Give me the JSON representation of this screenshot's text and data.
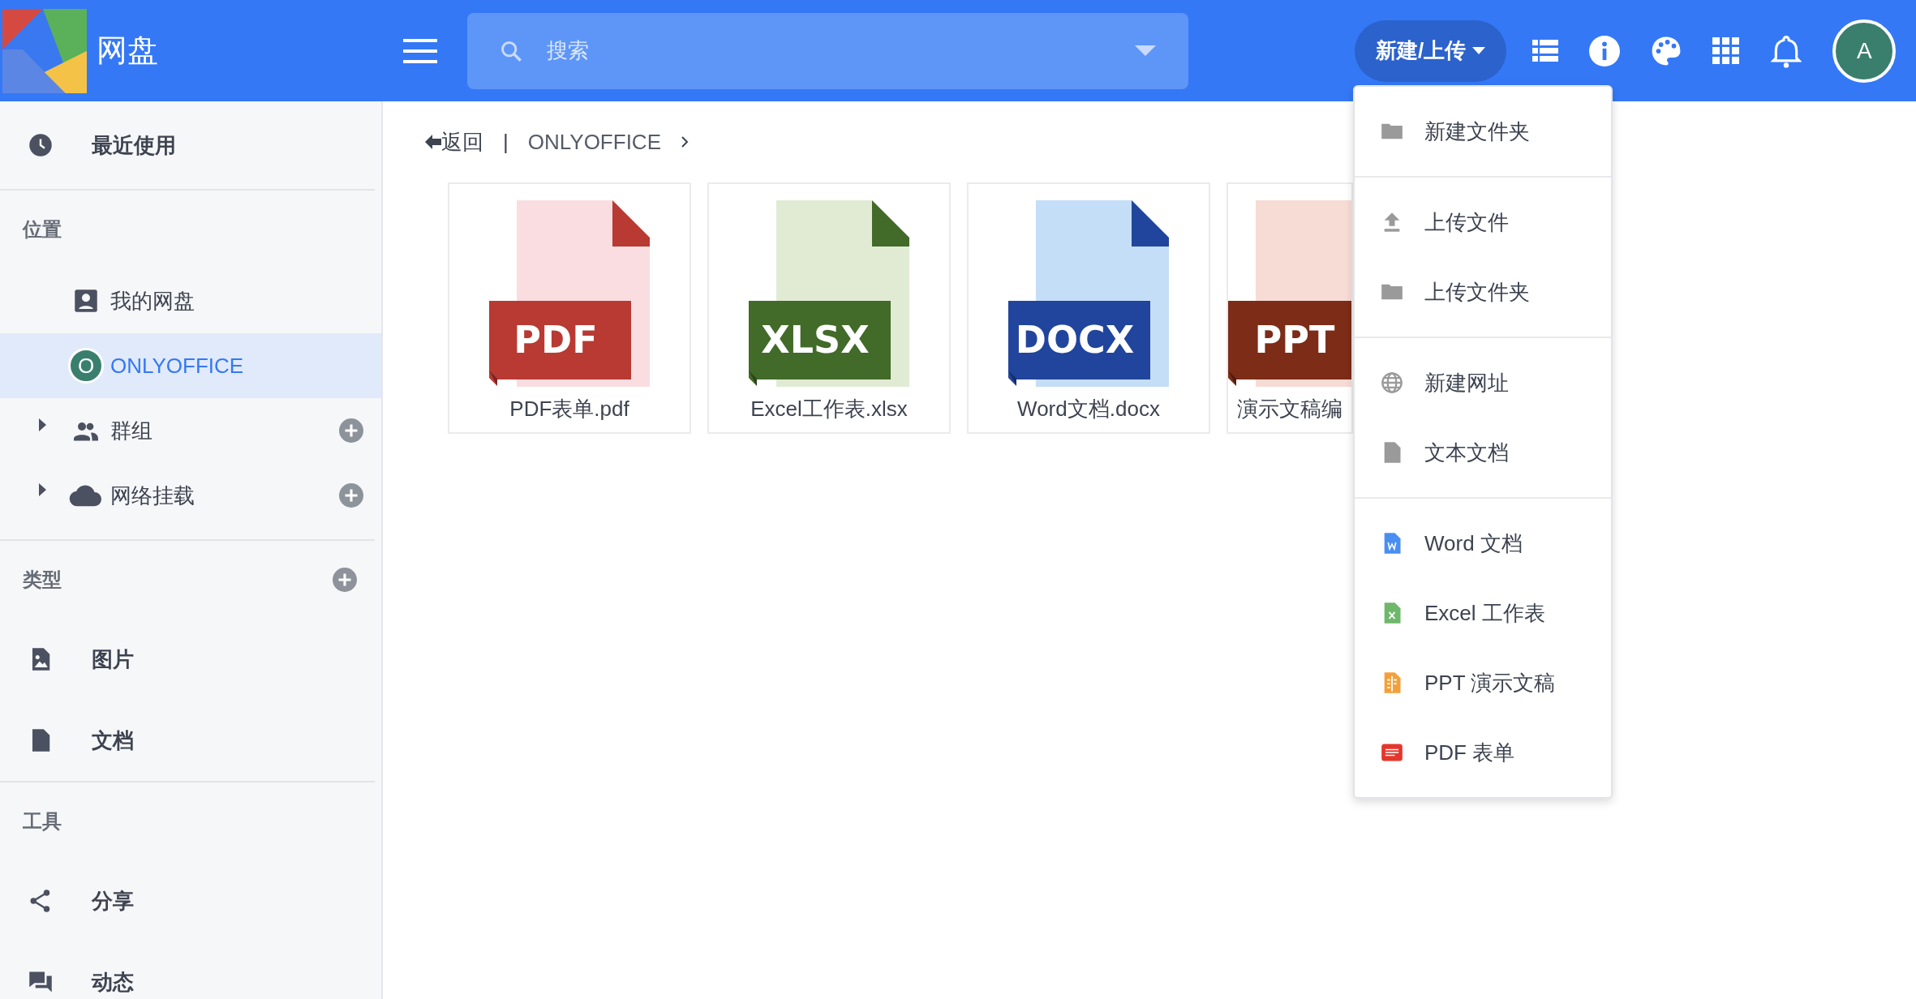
{
  "header": {
    "app_name": "网盘",
    "search": {
      "placeholder": "搜索"
    },
    "new_button": "新建/上传",
    "avatar": "A"
  },
  "sidebar": {
    "recent": {
      "label": "最近使用",
      "selected": false
    },
    "sections": [
      {
        "title": "位置",
        "add": false,
        "items": [
          {
            "kind": "person",
            "label": "我的网盘",
            "selected": false,
            "expandable": false,
            "add": false
          },
          {
            "kind": "letter",
            "badge": "O",
            "label": "ONLYOFFICE",
            "selected": true,
            "expandable": false,
            "add": false
          },
          {
            "kind": "people",
            "label": "群组",
            "selected": false,
            "expandable": true,
            "add": true
          },
          {
            "kind": "cloud",
            "label": "网络挂载",
            "selected": false,
            "expandable": true,
            "add": true
          }
        ]
      },
      {
        "title": "类型",
        "add": true,
        "items": [
          {
            "kind": "image",
            "label": "图片",
            "selected": false,
            "expandable": false,
            "add": false
          },
          {
            "kind": "file",
            "label": "文档",
            "selected": false,
            "expandable": false,
            "add": false
          }
        ]
      },
      {
        "title": "工具",
        "add": false,
        "items": [
          {
            "kind": "share",
            "label": "分享",
            "selected": false,
            "expandable": false,
            "add": false
          },
          {
            "kind": "chat",
            "label": "动态",
            "selected": false,
            "expandable": false,
            "add": false
          }
        ]
      }
    ]
  },
  "breadcrumb": {
    "back": "返回",
    "separator": "|",
    "path": [
      "ONLYOFFICE"
    ]
  },
  "files": [
    {
      "kind": "pdf",
      "badge": "PDF",
      "name": "PDF表单.pdf"
    },
    {
      "kind": "xlsx",
      "badge": "XLSX",
      "name": "Excel工作表.xlsx"
    },
    {
      "kind": "docx",
      "badge": "DOCX",
      "name": "Word文档.docx"
    },
    {
      "kind": "pptx",
      "badge": "PPT",
      "name": "演示文稿编"
    }
  ],
  "new_menu": {
    "groups": [
      {
        "items": [
          {
            "kind": "folder",
            "label": "新建文件夹"
          }
        ]
      },
      {
        "items": [
          {
            "kind": "upload",
            "label": "上传文件"
          },
          {
            "kind": "folder",
            "label": "上传文件夹"
          }
        ]
      },
      {
        "items": [
          {
            "kind": "globe",
            "label": "新建网址"
          },
          {
            "kind": "file",
            "label": "文本文档"
          }
        ]
      },
      {
        "items": [
          {
            "kind": "word",
            "label": "Word 文档"
          },
          {
            "kind": "excel",
            "label": "Excel 工作表"
          },
          {
            "kind": "ppt",
            "label": "PPT 演示文稿"
          },
          {
            "kind": "pdf",
            "label": "PDF 表单"
          }
        ]
      }
    ]
  }
}
